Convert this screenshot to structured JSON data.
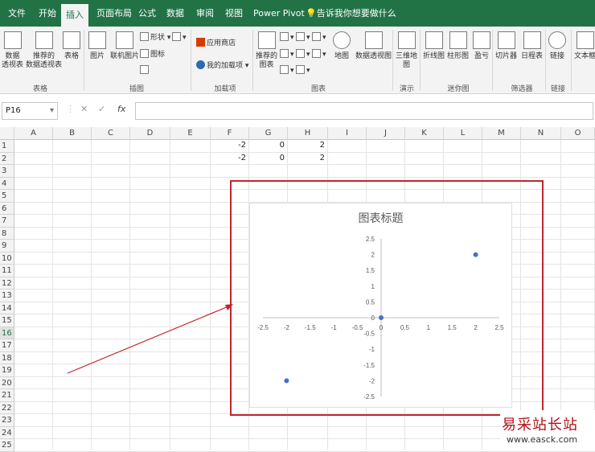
{
  "ribbon_tabs": [
    "文件",
    "开始",
    "插入",
    "页面布局",
    "公式",
    "数据",
    "审阅",
    "视图",
    "Power Pivot",
    "告诉我你想要做什么"
  ],
  "ribbon": {
    "pivot": [
      "数据",
      "透视表"
    ],
    "recommended_pivot": [
      "推荐的",
      "数据透视表"
    ],
    "table": "表格",
    "group_tables": "表格",
    "picture": "图片",
    "online_picture": "联机图片",
    "shapes": "形状",
    "icons": "图标",
    "group_illustrations": "插图",
    "store": "应用商店",
    "my_addins": "我的加载项",
    "group_addins": "加载项",
    "rec_charts": [
      "推荐的",
      "图表"
    ],
    "maps": "地图",
    "pivot_chart": "数据透视图",
    "group_charts": "图表",
    "map3d": [
      "三维地",
      "图"
    ],
    "group_tours": "演示",
    "spark_line": "折线图",
    "spark_column": "柱形图",
    "spark_winloss": "盈亏",
    "group_sparklines": "迷你图",
    "slicer": "切片器",
    "timeline": "日程表",
    "group_filters": "筛选器",
    "link": "链接",
    "group_links": "链接",
    "textbox": "文本框"
  },
  "formula_bar": {
    "name_box": "P16",
    "cancel": "✕",
    "enter": "✓",
    "fx": "fx"
  },
  "columns": [
    "A",
    "B",
    "C",
    "D",
    "E",
    "F",
    "G",
    "H",
    "I",
    "J",
    "K",
    "L",
    "M",
    "N",
    "O"
  ],
  "rows": [
    "1",
    "2",
    "3",
    "4",
    "5",
    "6",
    "7",
    "8",
    "9",
    "10",
    "11",
    "12",
    "13",
    "14",
    "15",
    "16",
    "17",
    "18",
    "19",
    "20",
    "21",
    "22",
    "23",
    "24",
    "25"
  ],
  "selected_row": "16",
  "cells": {
    "F1": "-2",
    "G1": "0",
    "H1": "2",
    "F2": "-2",
    "G2": "0",
    "H2": "2"
  },
  "chart_data": {
    "type": "scatter",
    "title": "图表标题",
    "xlim": [
      -2.5,
      2.5
    ],
    "ylim": [
      -2.5,
      2.5
    ],
    "x_ticks": [
      "-2.5",
      "-2",
      "-1.5",
      "-1",
      "-0.5",
      "0",
      "0.5",
      "1",
      "1.5",
      "2",
      "2.5"
    ],
    "y_ticks": [
      "2.5",
      "2",
      "1.5",
      "1",
      "0.5",
      "0",
      "-0.5",
      "-1",
      "-1.5",
      "-2",
      "-2.5"
    ],
    "series": [
      {
        "points": [
          [
            -2,
            -2
          ],
          [
            0,
            0
          ],
          [
            2,
            2
          ]
        ],
        "color": "#4472c4"
      }
    ]
  },
  "annotation": {
    "frame_color": "#c0262c",
    "arrow_color": "#c0262c"
  },
  "watermark": {
    "text": "易采站长站",
    "url": "www.easck.com"
  }
}
